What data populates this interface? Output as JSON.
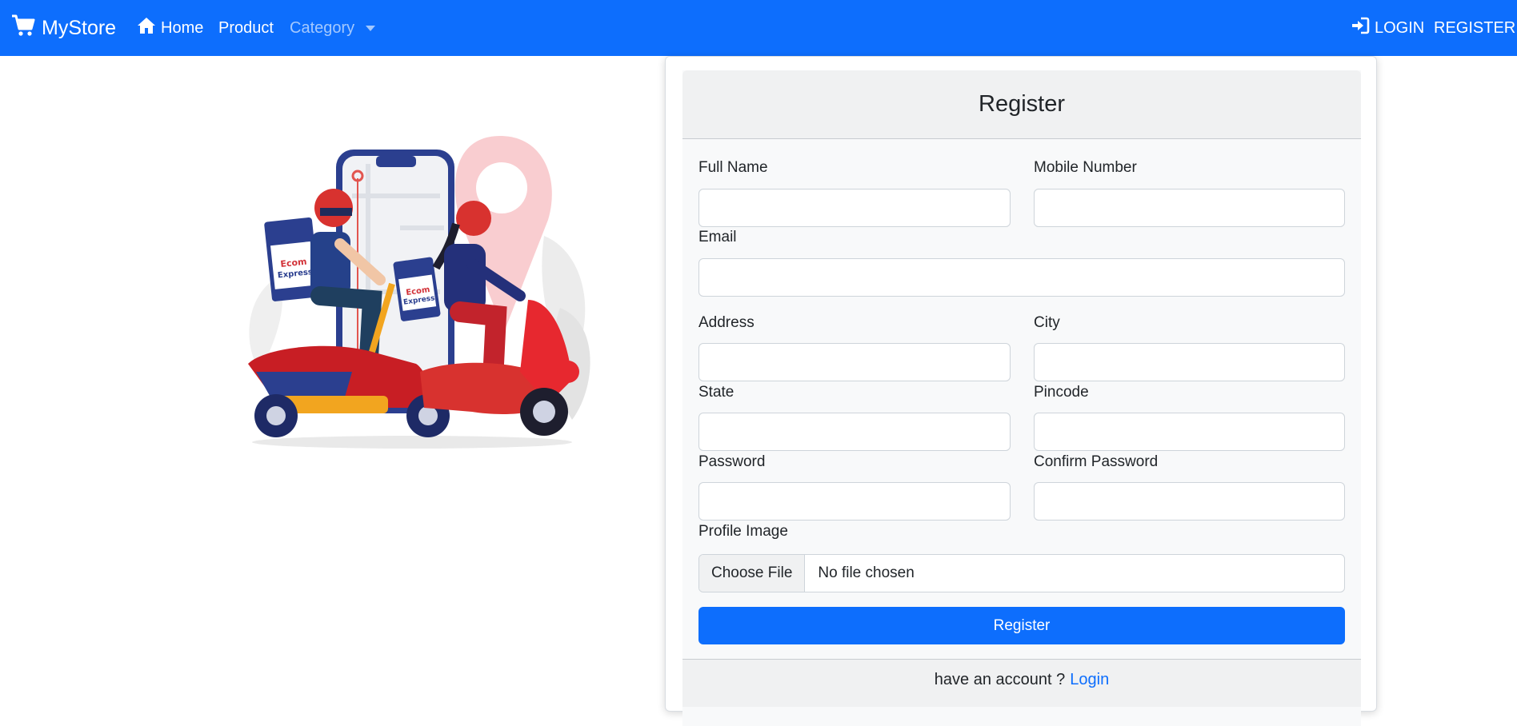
{
  "navbar": {
    "brand": "MyStore",
    "links": {
      "home": "Home",
      "product": "Product",
      "category": "Category",
      "login": "LOGIN",
      "register": "REGISTER"
    },
    "icons": {
      "brand": "cart-icon",
      "home": "home-icon",
      "login": "sign-in-icon"
    },
    "colors": {
      "background": "#0d6efd",
      "muted_link": "rgba(255,255,255,0.62)"
    }
  },
  "hero": {
    "description_icon": "delivery-scooter-illustration",
    "box_brand_line1": "Ecom",
    "box_brand_line2": "Express"
  },
  "register_card": {
    "title": "Register",
    "fields": {
      "full_name": {
        "label": "Full Name",
        "value": ""
      },
      "mobile": {
        "label": "Mobile Number",
        "value": ""
      },
      "email": {
        "label": "Email",
        "value": ""
      },
      "address": {
        "label": "Address",
        "value": ""
      },
      "city": {
        "label": "City",
        "value": ""
      },
      "state": {
        "label": "State",
        "value": ""
      },
      "pincode": {
        "label": "Pincode",
        "value": ""
      },
      "password": {
        "label": "Password",
        "value": ""
      },
      "confirm_password": {
        "label": "Confirm Password",
        "value": ""
      },
      "profile_image": {
        "label": "Profile Image",
        "button_label": "Choose File",
        "status": "No file chosen"
      }
    },
    "submit_label": "Register",
    "footer": {
      "text": "have an account ?",
      "link_label": "Login"
    },
    "colors": {
      "primary": "#0d6efd",
      "header_bg": "#f0f1f2",
      "body_bg": "#f8f9fa"
    }
  }
}
